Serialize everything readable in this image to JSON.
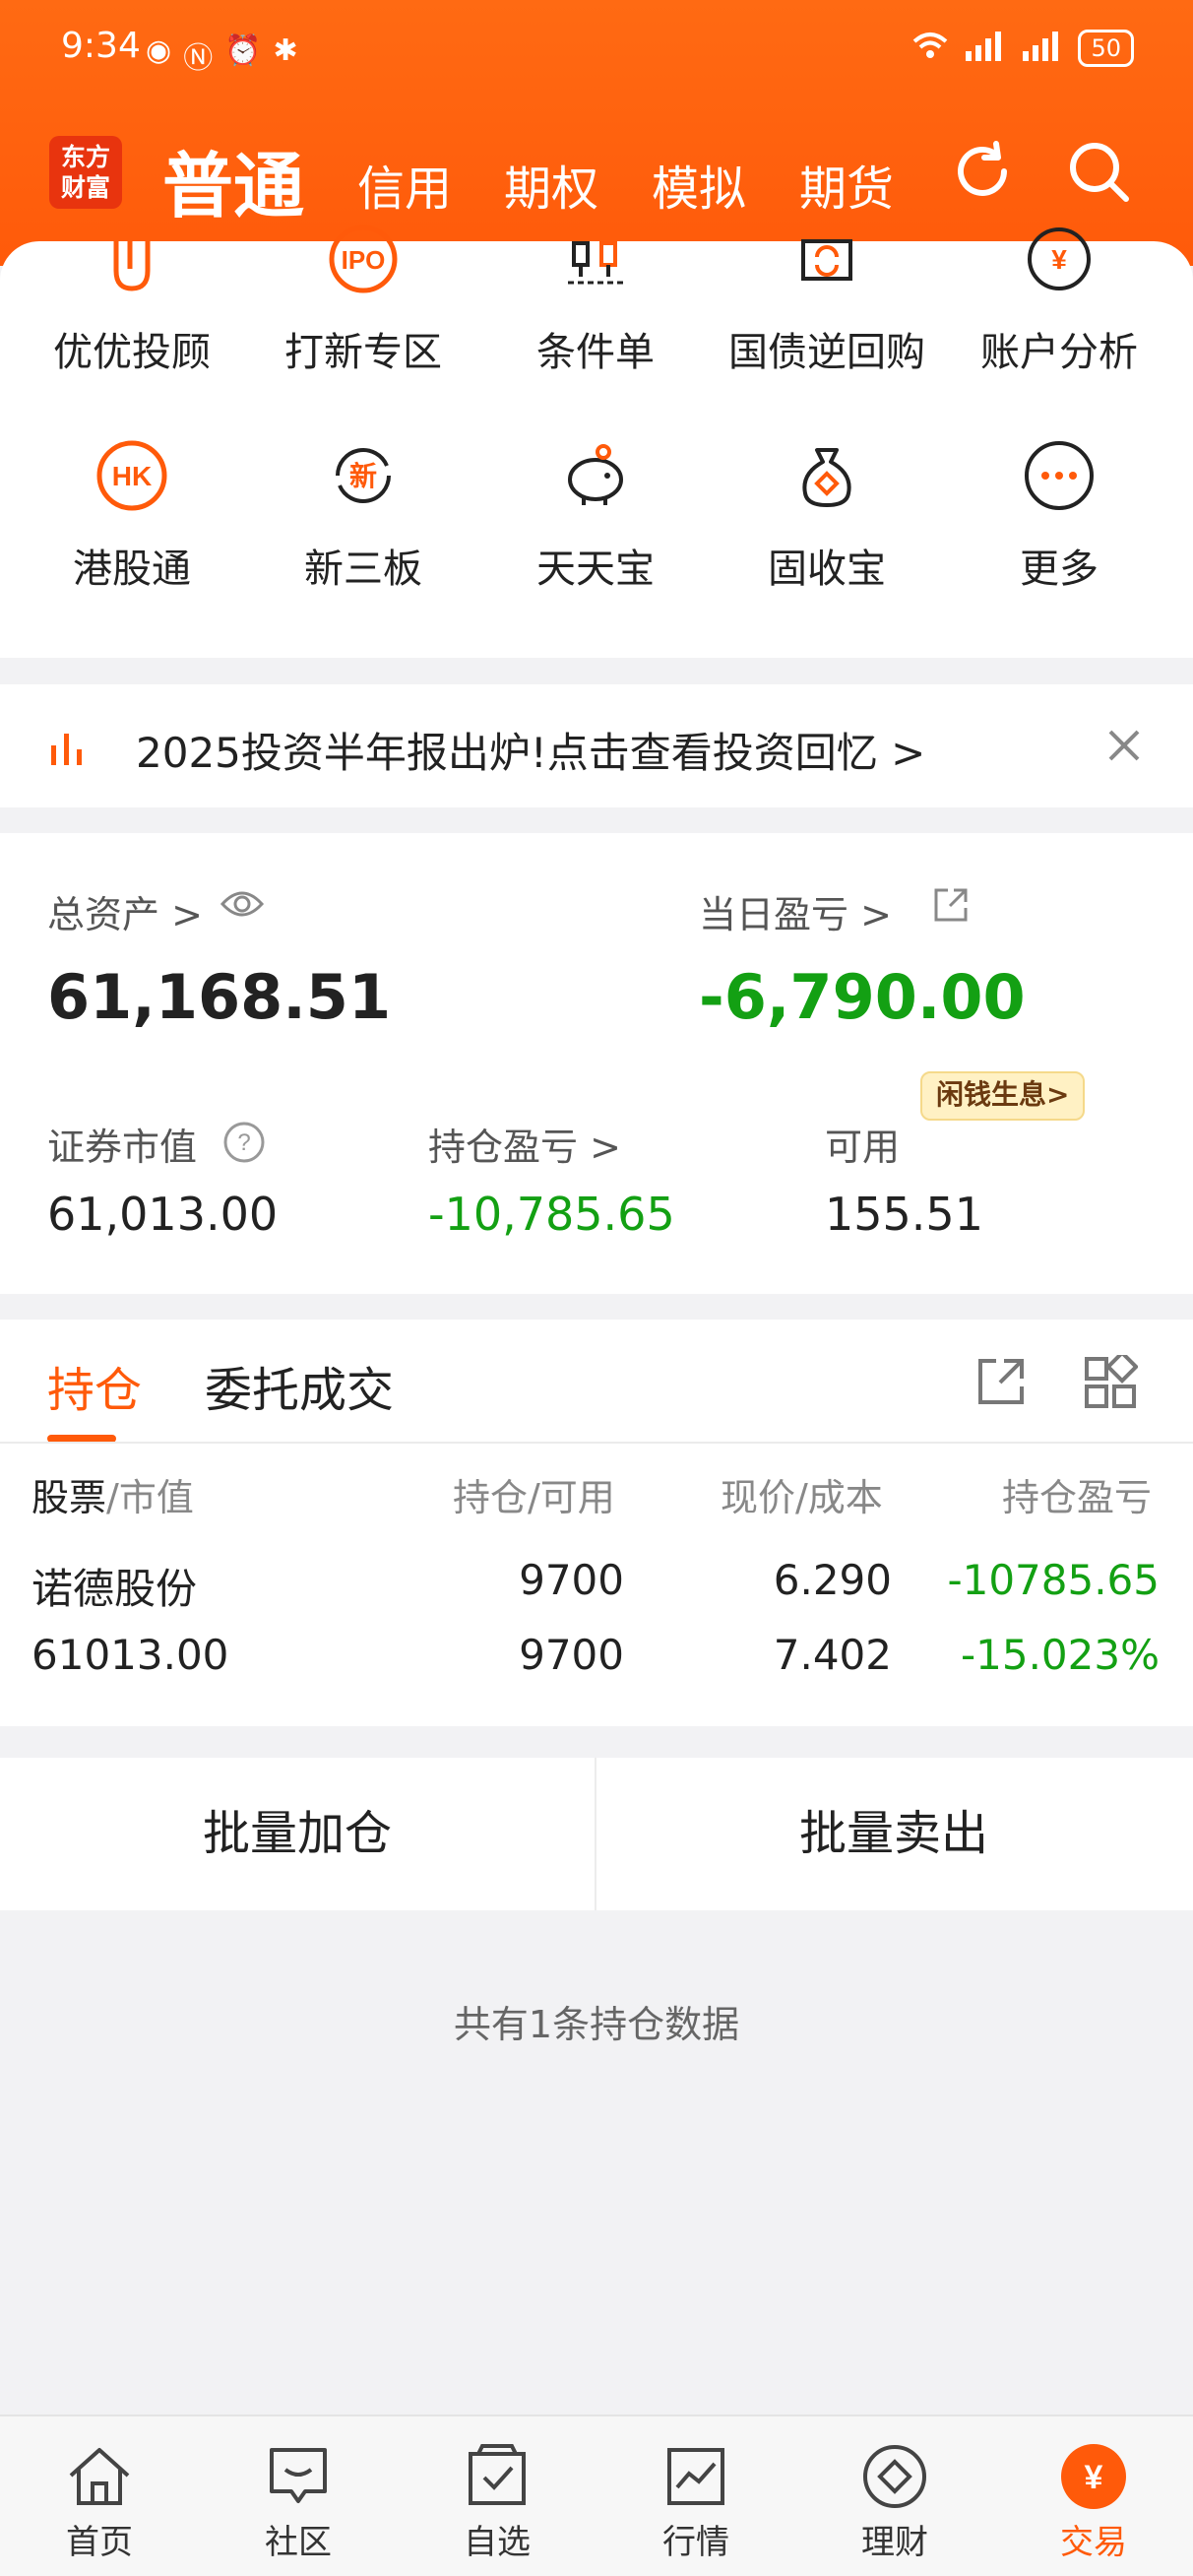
{
  "status_bar": {
    "time": "9:34",
    "battery": "50"
  },
  "header": {
    "logo_line1": "东方",
    "logo_line2": "财富",
    "tabs": [
      {
        "label": "普通"
      },
      {
        "label": "信用"
      },
      {
        "label": "期权"
      },
      {
        "label": "模拟"
      },
      {
        "label": "期货"
      }
    ]
  },
  "shortcuts": {
    "row1": [
      {
        "label": "优优投顾",
        "icon": "advisor-icon"
      },
      {
        "label": "打新专区",
        "icon": "ipo-icon",
        "icon_text": "IPO"
      },
      {
        "label": "条件单",
        "icon": "condition-order-icon"
      },
      {
        "label": "国债逆回购",
        "icon": "reverse-repo-icon"
      },
      {
        "label": "账户分析",
        "icon": "account-analysis-icon",
        "icon_text": "¥"
      }
    ],
    "row2": [
      {
        "label": "港股通",
        "icon": "hk-icon",
        "icon_text": "HK"
      },
      {
        "label": "新三板",
        "icon": "new-third-board-icon",
        "icon_text": "新"
      },
      {
        "label": "天天宝",
        "icon": "piggy-bank-icon"
      },
      {
        "label": "固收宝",
        "icon": "money-bag-icon"
      },
      {
        "label": "更多",
        "icon": "more-icon"
      }
    ]
  },
  "banner": {
    "text": "2025投资半年报出炉!点击查看投资回忆 >"
  },
  "assets": {
    "total_label": "总资产 >",
    "total_value": "61,168.51",
    "daily_pl_label": "当日盈亏 >",
    "daily_pl_value": "-6,790.00",
    "market_value_label": "证券市值",
    "market_value": "61,013.00",
    "position_pl_label": "持仓盈亏 >",
    "position_pl_value": "-10,785.65",
    "available_label": "可用",
    "available_value": "155.51",
    "badge": "闲钱生息>"
  },
  "positions": {
    "tabs": [
      "持仓",
      "委托成交"
    ],
    "headers": {
      "col1_a": "股票",
      "col1_b": "/市值",
      "col2": "持仓/可用",
      "col3": "现价/成本",
      "col4": "持仓盈亏"
    },
    "rows": [
      {
        "name": "诺德股份",
        "market_value": "61013.00",
        "holding": "9700",
        "available": "9700",
        "price": "6.290",
        "cost": "7.402",
        "pl": "-10785.65",
        "pl_pct": "-15.023%"
      }
    ]
  },
  "batch": {
    "add": "批量加仓",
    "sell": "批量卖出"
  },
  "summary": {
    "count_text": "共有1条持仓数据"
  },
  "bottom_nav": [
    {
      "label": "首页",
      "icon": "home-icon"
    },
    {
      "label": "社区",
      "icon": "community-icon"
    },
    {
      "label": "自选",
      "icon": "watchlist-icon"
    },
    {
      "label": "行情",
      "icon": "market-icon"
    },
    {
      "label": "理财",
      "icon": "wealth-icon"
    },
    {
      "label": "交易",
      "icon": "trade-icon",
      "icon_text": "¥",
      "active": true
    }
  ],
  "colors": {
    "brand": "#ff5a0a",
    "loss": "#13a013",
    "text": "#222222"
  }
}
